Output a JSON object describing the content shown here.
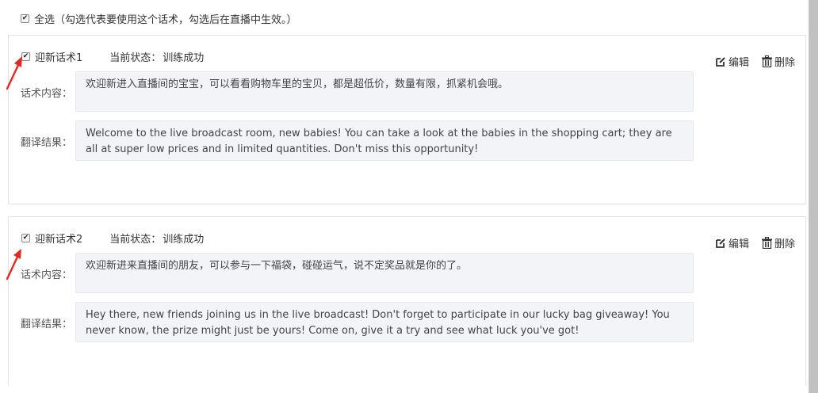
{
  "select_all": {
    "checked": true,
    "label": "全选（勾选代表要使用这个话术，勾选后在直播中生效。）"
  },
  "cards": [
    {
      "checked": true,
      "name": "迎新话术1",
      "status_label": "当前状态：",
      "status_value": "训练成功",
      "edit_label": "编辑",
      "delete_label": "删除",
      "content_label": "话术内容：",
      "content": "欢迎新进入直播间的宝宝，可以看看购物车里的宝贝，都是超低价，数量有限，抓紧机会哦。",
      "translation_label": "翻译结果：",
      "translation": "Welcome to the live broadcast room, new babies! You can take a look at the babies in the shopping cart; they are all at super low prices and in limited quantities. Don't miss this opportunity!"
    },
    {
      "checked": true,
      "name": "迎新话术2",
      "status_label": "当前状态：",
      "status_value": "训练成功",
      "edit_label": "编辑",
      "delete_label": "删除",
      "content_label": "话术内容：",
      "content": "欢迎新进来直播间的朋友，可以参与一下福袋，碰碰运气，说不定奖品就是你的了。",
      "translation_label": "翻译结果：",
      "translation": "Hey there, new friends joining us in the live broadcast! Don't forget to participate in our lucky bag giveaway! You never know, the prize might just be yours! Come on, give it a try and see what luck you've got!"
    }
  ],
  "colors": {
    "annotation_arrow": "#e8261f",
    "field_bg": "#f3f4f8",
    "scrollbar_thumb": "#c1c1c1"
  },
  "icons": [
    "checkbox-icon",
    "edit-icon",
    "trash-icon",
    "arrow-annotation"
  ]
}
